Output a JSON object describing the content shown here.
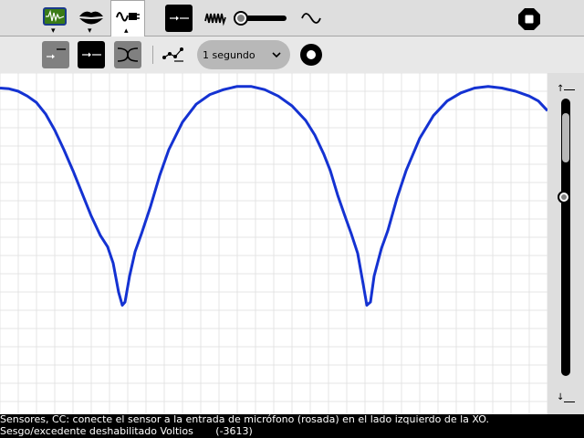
{
  "toolbar": {
    "tabs": [
      {
        "icon": "oscilloscope-icon",
        "active": false
      },
      {
        "icon": "lips-icon",
        "active": false
      },
      {
        "icon": "sensor-plug-icon",
        "active": true
      }
    ],
    "mode_buttons": [
      "dc-mode-icon",
      "ac-waveform-icon",
      "sine-wave-icon"
    ],
    "stop_icon": "stop-icon"
  },
  "sensor_toolbar": {
    "time_select": {
      "value": "1 segundo"
    },
    "record_icon": "record-icon"
  },
  "slider": {
    "top_label": "↑",
    "bottom_label": "↓",
    "level": 0.86
  },
  "chart_data": {
    "type": "line",
    "title": "",
    "xlabel": "",
    "ylabel": "",
    "grid": true,
    "series": [
      {
        "color": "#1432d2",
        "points": [
          [
            0,
            0.96
          ],
          [
            10,
            0.955
          ],
          [
            20,
            0.94
          ],
          [
            30,
            0.91
          ],
          [
            40,
            0.87
          ],
          [
            50,
            0.8
          ],
          [
            60,
            0.7
          ],
          [
            70,
            0.58
          ],
          [
            80,
            0.45
          ],
          [
            90,
            0.31
          ],
          [
            100,
            0.17
          ],
          [
            110,
            0.05
          ],
          [
            118,
            -0.02
          ],
          [
            124,
            -0.12
          ],
          [
            130,
            -0.3
          ],
          [
            134,
            -0.38
          ],
          [
            137,
            -0.36
          ],
          [
            142,
            -0.2
          ],
          [
            148,
            -0.05
          ],
          [
            155,
            0.06
          ],
          [
            165,
            0.23
          ],
          [
            175,
            0.42
          ],
          [
            185,
            0.58
          ],
          [
            200,
            0.75
          ],
          [
            215,
            0.86
          ],
          [
            230,
            0.92
          ],
          [
            245,
            0.95
          ],
          [
            260,
            0.97
          ],
          [
            275,
            0.97
          ],
          [
            290,
            0.95
          ],
          [
            305,
            0.91
          ],
          [
            320,
            0.85
          ],
          [
            335,
            0.76
          ],
          [
            345,
            0.67
          ],
          [
            355,
            0.55
          ],
          [
            362,
            0.45
          ],
          [
            370,
            0.3
          ],
          [
            378,
            0.17
          ],
          [
            385,
            0.06
          ],
          [
            392,
            -0.06
          ],
          [
            398,
            -0.25
          ],
          [
            402,
            -0.38
          ],
          [
            406,
            -0.36
          ],
          [
            410,
            -0.2
          ],
          [
            418,
            -0.03
          ],
          [
            425,
            0.08
          ],
          [
            435,
            0.28
          ],
          [
            445,
            0.45
          ],
          [
            460,
            0.65
          ],
          [
            475,
            0.79
          ],
          [
            490,
            0.88
          ],
          [
            505,
            0.93
          ],
          [
            520,
            0.96
          ],
          [
            535,
            0.97
          ],
          [
            550,
            0.96
          ],
          [
            565,
            0.94
          ],
          [
            580,
            0.91
          ],
          [
            590,
            0.88
          ],
          [
            600,
            0.82
          ]
        ]
      }
    ]
  },
  "status": {
    "line1": "Sensores, CC: conecte el sensor a la entrada de micrófono (rosada) en el lado izquierdo de la XO.",
    "line2": "Sesgo/excedente deshabilitado Voltios       (-3613)"
  }
}
